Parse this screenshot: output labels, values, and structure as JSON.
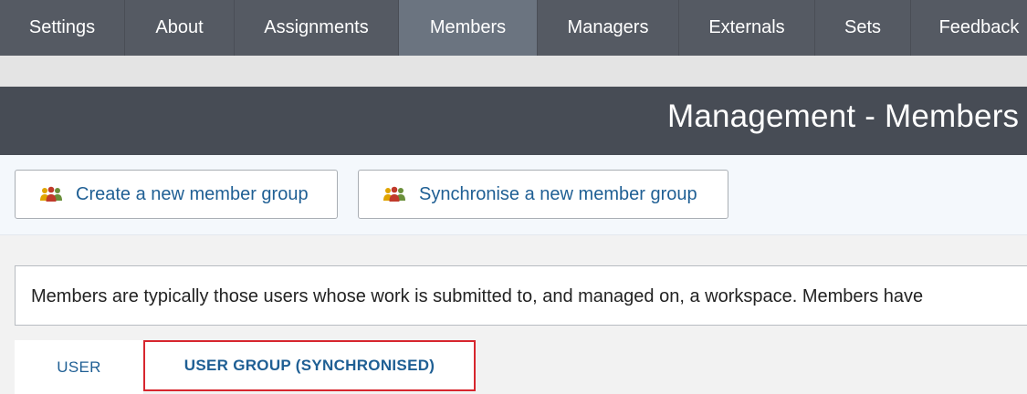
{
  "nav": {
    "tabs": [
      {
        "label": "Settings",
        "active": false
      },
      {
        "label": "About",
        "active": false
      },
      {
        "label": "Assignments",
        "active": false
      },
      {
        "label": "Members",
        "active": true
      },
      {
        "label": "Managers",
        "active": false
      },
      {
        "label": "Externals",
        "active": false
      },
      {
        "label": "Sets",
        "active": false
      },
      {
        "label": "Feedback",
        "active": false
      }
    ]
  },
  "header": {
    "title": "Management - Members"
  },
  "toolbar": {
    "create_label": "Create a new member group",
    "create_icon": "people-group-icon",
    "sync_label": "Synchronise a new member group",
    "sync_icon": "people-group-icon"
  },
  "info": {
    "text": "Members are typically those users whose work is submitted to, and managed on, a workspace. Members have"
  },
  "subtabs": {
    "user_label": "USER",
    "group_label": "USER GROUP (SYNCHRONISED)",
    "selected": "USER GROUP (SYNCHRONISED)"
  },
  "colors": {
    "nav_bg": "#555a63",
    "nav_active": "#6b7480",
    "header_bg": "#474c55",
    "link": "#1f5f94",
    "highlight": "#d7262e"
  }
}
